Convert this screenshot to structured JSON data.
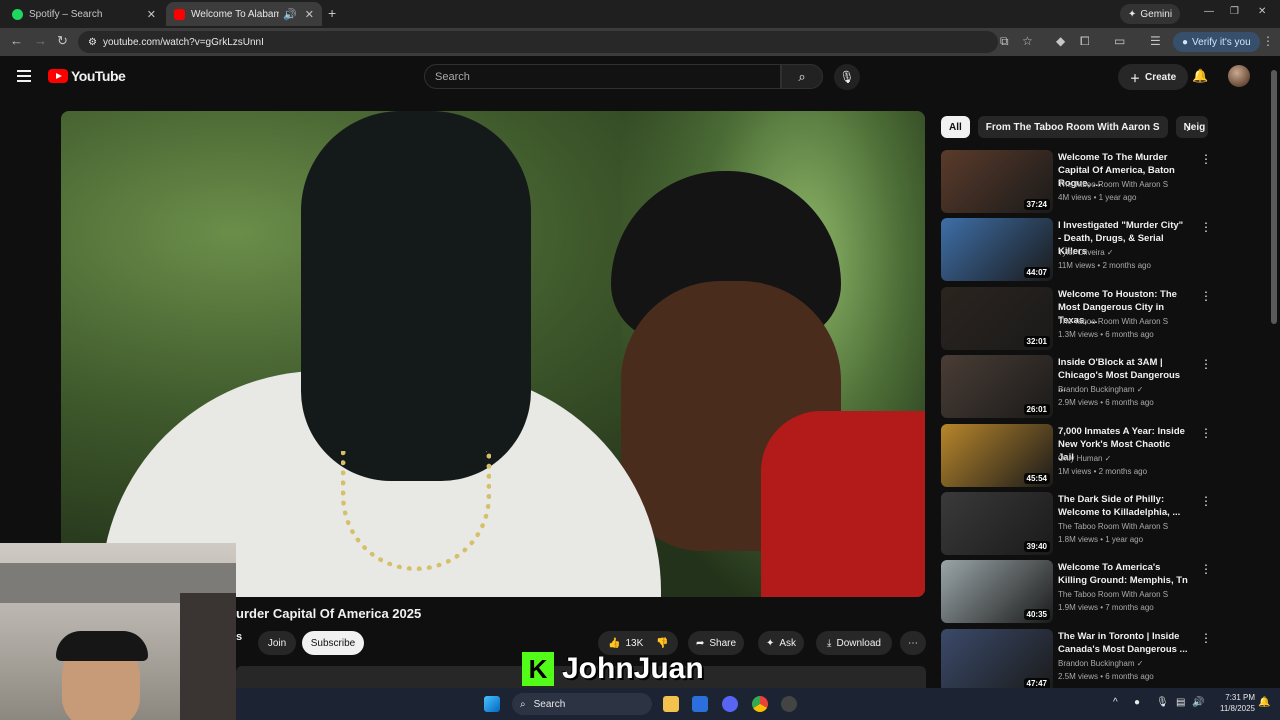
{
  "browser": {
    "tabs": [
      {
        "label": "Spotify – Search",
        "close": "✕"
      },
      {
        "label": "Welcome To Alabama: The ",
        "close": "✕"
      }
    ],
    "new_tab": "+",
    "gemini_label": "Gemini",
    "url": "youtube.com/watch?v=gGrkLzsUnnI",
    "verify_label": "Verify it's you"
  },
  "youtube": {
    "logo_text": "YouTube",
    "search_placeholder": "Search",
    "create_label": "Create"
  },
  "video": {
    "title": "urder Capital Of America 2025",
    "channel_fragment": "s",
    "join_label": "Join",
    "subscribe_label": "Subscribe",
    "likes": "13K",
    "share_label": "Share",
    "ask_label": "Ask",
    "download_label": "Download"
  },
  "overlay": {
    "kick_letter": "K",
    "streamer_name": "JohnJuan"
  },
  "chips": [
    "All",
    "From The Taboo Room With Aaron S",
    "Neig"
  ],
  "recommendations": [
    {
      "title": "Welcome To The Murder Capital Of America, Baton Rogue, ...",
      "channel": "The Taboo Room With Aaron S",
      "meta": "4M views • 1 year ago",
      "duration": "37:24",
      "color": "#5a3b2a"
    },
    {
      "title": "I Investigated \"Murder City\" - Death, Drugs, & Serial Killers",
      "channel": "Tyler Oliveira ✓",
      "meta": "11M views • 2 months ago",
      "duration": "44:07",
      "color": "#3e6fa8"
    },
    {
      "title": "Welcome To Houston: The Most Dangerous City in Texas, ...",
      "channel": "The Taboo Room With Aaron S",
      "meta": "1.3M views • 6 months ago",
      "duration": "32:01",
      "color": "#2b241f"
    },
    {
      "title": "Inside O'Block at 3AM | Chicago's Most Dangerous ...",
      "channel": "Brandon Buckingham ✓",
      "meta": "2.9M views • 6 months ago",
      "duration": "26:01",
      "color": "#4a3d35"
    },
    {
      "title": "7,000 Inmates A Year: Inside New York's Most Chaotic Jail",
      "channel": "Only Human ✓",
      "meta": "1M views • 2 months ago",
      "duration": "45:54",
      "color": "#b8862b"
    },
    {
      "title": "The Dark Side of Philly: Welcome to Killadelphia, ...",
      "channel": "The Taboo Room With Aaron S",
      "meta": "1.8M views • 1 year ago",
      "duration": "39:40",
      "color": "#3a3a3a"
    },
    {
      "title": "Welcome To America's Killing Ground: Memphis, Tn",
      "channel": "The Taboo Room With Aaron S",
      "meta": "1.9M views • 7 months ago",
      "duration": "40:35",
      "color": "#9aa5a8"
    },
    {
      "title": "The War in Toronto | Inside Canada's Most Dangerous ...",
      "channel": "Brandon Buckingham ✓",
      "meta": "2.5M views • 6 months ago",
      "duration": "47:47",
      "color": "#3b4a6a"
    }
  ],
  "taskbar": {
    "search_label": "Search",
    "time": "7:31 PM",
    "date": "11/8/2025"
  }
}
